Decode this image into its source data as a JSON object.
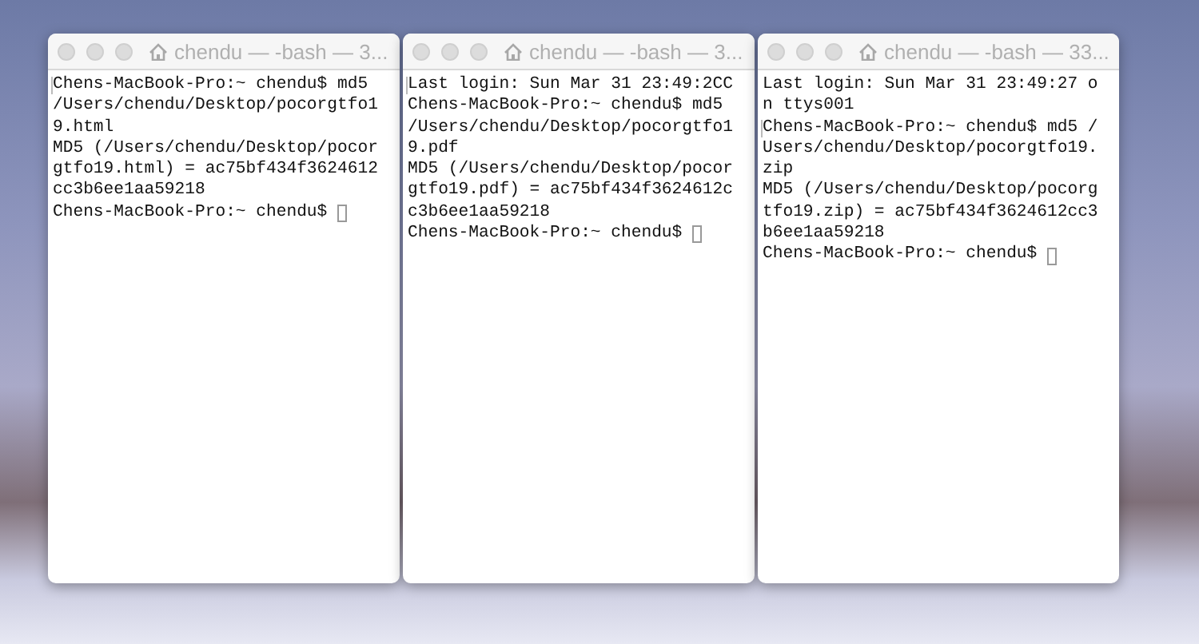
{
  "windows": [
    {
      "title": "chendu — -bash — 3...",
      "lines": [
        {
          "text": "Chens-MacBook-Pro:~ chendu$ md5",
          "marked": true,
          "cursor": false
        },
        {
          "text": "/Users/chendu/Desktop/pocorgtfo1",
          "marked": false,
          "cursor": false
        },
        {
          "text": "9.html",
          "marked": false,
          "cursor": false
        },
        {
          "text": "MD5 (/Users/chendu/Desktop/pocor",
          "marked": false,
          "cursor": false
        },
        {
          "text": "gtfo19.html) = ac75bf434f3624612",
          "marked": false,
          "cursor": false
        },
        {
          "text": "cc3b6ee1aa59218",
          "marked": false,
          "cursor": false
        },
        {
          "text": "Chens-MacBook-Pro:~ chendu$",
          "marked": false,
          "cursor": true
        }
      ]
    },
    {
      "title": "chendu — -bash — 3...",
      "lines": [
        {
          "text": "Last login: Sun Mar 31 23:49:2CC",
          "marked": true,
          "cursor": false
        },
        {
          "text": "Chens-MacBook-Pro:~ chendu$ md5",
          "marked": false,
          "cursor": false
        },
        {
          "text": "/Users/chendu/Desktop/pocorgtfo1",
          "marked": false,
          "cursor": false
        },
        {
          "text": "9.pdf",
          "marked": false,
          "cursor": false
        },
        {
          "text": "MD5 (/Users/chendu/Desktop/pocor",
          "marked": false,
          "cursor": false
        },
        {
          "text": "gtfo19.pdf) = ac75bf434f3624612c",
          "marked": false,
          "cursor": false
        },
        {
          "text": "c3b6ee1aa59218",
          "marked": false,
          "cursor": false
        },
        {
          "text": "Chens-MacBook-Pro:~ chendu$",
          "marked": false,
          "cursor": true
        }
      ]
    },
    {
      "title": "chendu — -bash — 33...",
      "lines": [
        {
          "text": "Last login: Sun Mar 31 23:49:27 o",
          "marked": false,
          "cursor": false
        },
        {
          "text": "n ttys001",
          "marked": false,
          "cursor": false
        },
        {
          "text": "Chens-MacBook-Pro:~ chendu$ md5 /",
          "marked": true,
          "cursor": false
        },
        {
          "text": "Users/chendu/Desktop/pocorgtfo19.",
          "marked": false,
          "cursor": false
        },
        {
          "text": "zip",
          "marked": false,
          "cursor": false
        },
        {
          "text": "MD5 (/Users/chendu/Desktop/pocorg",
          "marked": false,
          "cursor": false
        },
        {
          "text": "tfo19.zip) = ac75bf434f3624612cc3",
          "marked": false,
          "cursor": false
        },
        {
          "text": "b6ee1aa59218",
          "marked": false,
          "cursor": false
        },
        {
          "text": "Chens-MacBook-Pro:~ chendu$",
          "marked": false,
          "cursor": true
        }
      ]
    }
  ]
}
